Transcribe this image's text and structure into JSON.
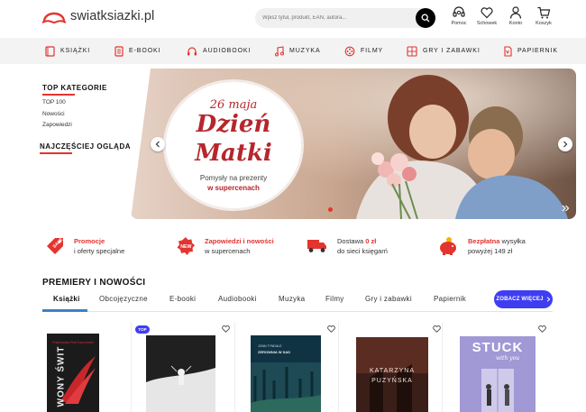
{
  "header": {
    "logo_text": "swiatksiazki.pl",
    "search_placeholder": "Wpisz tytuł, produkt, EAN, autora...",
    "tools": [
      {
        "label": "Pomoc",
        "icon": "headset-icon"
      },
      {
        "label": "Schowek",
        "icon": "heart-icon"
      },
      {
        "label": "Konto",
        "icon": "user-icon"
      },
      {
        "label": "Koszyk",
        "icon": "cart-icon"
      }
    ]
  },
  "nav": {
    "items": [
      {
        "label": "KSIĄŻKI",
        "icon": "book-icon"
      },
      {
        "label": "E-BOOKI",
        "icon": "ebook-icon"
      },
      {
        "label": "AUDIOBOOKI",
        "icon": "headphones-icon"
      },
      {
        "label": "MUZYKA",
        "icon": "music-note-icon"
      },
      {
        "label": "FILMY",
        "icon": "film-icon"
      },
      {
        "label": "GRY I ZABAWKI",
        "icon": "game-icon"
      },
      {
        "label": "PAPIERNIK",
        "icon": "paper-icon"
      }
    ]
  },
  "sidebar": {
    "top_title": "TOP KATEGORIE",
    "links": [
      "TOP 100",
      "Nowości",
      "Zapowiedzi"
    ],
    "seen_title": "NAJCZĘŚCIEJ OGLĄDANE"
  },
  "hero": {
    "date": "26 maja",
    "title_line1": "Dzień",
    "title_line2": "Matki",
    "subtitle1": "Pomysły na prezenty",
    "subtitle2": "w supercenach"
  },
  "benefits": [
    {
      "highlight": "Promocje",
      "rest": "",
      "line2": "i oferty specjalne",
      "icon": "sale-tag-icon"
    },
    {
      "highlight": "Zapowiedzi i nowości",
      "rest": "",
      "line2": "w supercenach",
      "icon": "new-badge-icon"
    },
    {
      "highlight": "",
      "pre": "Dostawa ",
      "highlight_mid": "0 zł",
      "line2": "do sieci księgarń",
      "icon": "truck-icon"
    },
    {
      "highlight": "Bezpłatna",
      "rest": " wysyłka",
      "line2": "powyżej 149 zł",
      "icon": "piggy-bank-icon"
    }
  ],
  "section": {
    "title": "PREMIERY I NOWOŚCI",
    "tabs": [
      "Książki",
      "Obcojęzyczne",
      "E-booki",
      "Audiobooki",
      "Muzyka",
      "Filmy",
      "Gry i zabawki",
      "Papiernik"
    ],
    "more_label": "ZOBACZ WIĘCEJ",
    "badge_top": "TOP"
  },
  "books": [
    {
      "cover_text": "WONY ŚWIT",
      "cover_sub": "Przemysław Piotr Kaczmarek"
    },
    {
      "cover_text": "",
      "cover_sub": ""
    },
    {
      "cover_text": "ZEROWNIA W SAD",
      "cover_sub": "JONN TYNDALE"
    },
    {
      "cover_text": "KATARZYNA PUZYŃSKA",
      "cover_sub": ""
    },
    {
      "cover_text": "STUCK",
      "cover_sub": "with you"
    }
  ],
  "colors": {
    "accent_red": "#e3342f",
    "accent_blue": "#3f3df2",
    "hero_red": "#b5272d"
  }
}
